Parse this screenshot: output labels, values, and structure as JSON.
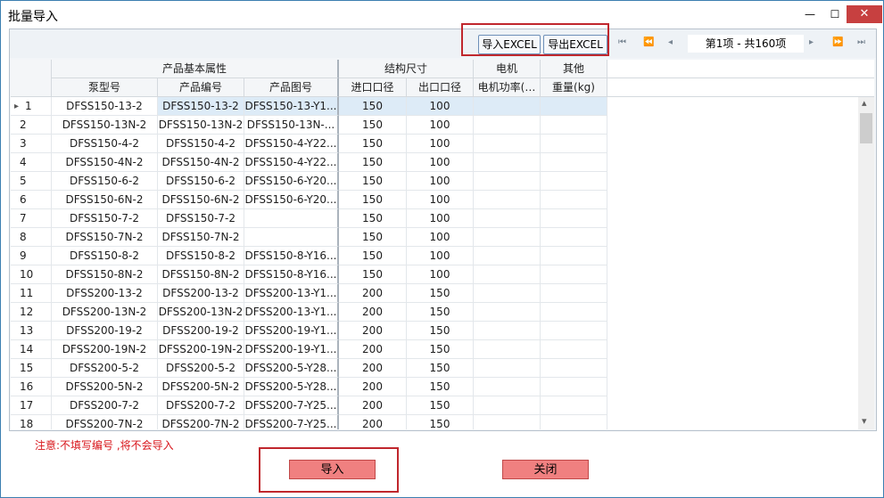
{
  "window": {
    "title": "批量导入",
    "minimize": "—",
    "maximize": "☐",
    "close": "✕"
  },
  "toolbar": {
    "import_excel": "导入EXCEL",
    "export_excel": "导出EXCEL",
    "nav_first": "⏮",
    "nav_prev": "⏪",
    "page_info": "第1项 - 共160项",
    "nav_next": "▸",
    "nav_fast": "⏩",
    "nav_last": "⏭"
  },
  "groups": {
    "basic": "产品基本属性",
    "structure": "结构尺寸",
    "motor": "电机",
    "other": "其他"
  },
  "columns": {
    "pump_model": "泵型号",
    "product_code": "产品编号",
    "product_drawing": "产品图号",
    "inlet": "进口口径",
    "outlet": "出口口径",
    "motor_power": "电机功率(…",
    "weight": "重量(kg)"
  },
  "rows": [
    {
      "n": "1",
      "model": "DFSS150-13-2",
      "code": "DFSS150-13-2",
      "drawing": "DFSS150-13-Y1...",
      "inlet": "150",
      "outlet": "100",
      "current": "▸"
    },
    {
      "n": "2",
      "model": "DFSS150-13N-2",
      "code": "DFSS150-13N-2",
      "drawing": "DFSS150-13N-...",
      "inlet": "150",
      "outlet": "100"
    },
    {
      "n": "3",
      "model": "DFSS150-4-2",
      "code": "DFSS150-4-2",
      "drawing": "DFSS150-4-Y22...",
      "inlet": "150",
      "outlet": "100"
    },
    {
      "n": "4",
      "model": "DFSS150-4N-2",
      "code": "DFSS150-4N-2",
      "drawing": "DFSS150-4-Y22...",
      "inlet": "150",
      "outlet": "100"
    },
    {
      "n": "5",
      "model": "DFSS150-6-2",
      "code": "DFSS150-6-2",
      "drawing": "DFSS150-6-Y20...",
      "inlet": "150",
      "outlet": "100"
    },
    {
      "n": "6",
      "model": "DFSS150-6N-2",
      "code": "DFSS150-6N-2",
      "drawing": "DFSS150-6-Y20...",
      "inlet": "150",
      "outlet": "100"
    },
    {
      "n": "7",
      "model": "DFSS150-7-2",
      "code": "DFSS150-7-2",
      "drawing": "",
      "inlet": "150",
      "outlet": "100"
    },
    {
      "n": "8",
      "model": "DFSS150-7N-2",
      "code": "DFSS150-7N-2",
      "drawing": "",
      "inlet": "150",
      "outlet": "100"
    },
    {
      "n": "9",
      "model": "DFSS150-8-2",
      "code": "DFSS150-8-2",
      "drawing": "DFSS150-8-Y16...",
      "inlet": "150",
      "outlet": "100"
    },
    {
      "n": "10",
      "model": "DFSS150-8N-2",
      "code": "DFSS150-8N-2",
      "drawing": "DFSS150-8-Y16...",
      "inlet": "150",
      "outlet": "100"
    },
    {
      "n": "11",
      "model": "DFSS200-13-2",
      "code": "DFSS200-13-2",
      "drawing": "DFSS200-13-Y1...",
      "inlet": "200",
      "outlet": "150"
    },
    {
      "n": "12",
      "model": "DFSS200-13N-2",
      "code": "DFSS200-13N-2",
      "drawing": "DFSS200-13-Y1...",
      "inlet": "200",
      "outlet": "150"
    },
    {
      "n": "13",
      "model": "DFSS200-19-2",
      "code": "DFSS200-19-2",
      "drawing": "DFSS200-19-Y1...",
      "inlet": "200",
      "outlet": "150"
    },
    {
      "n": "14",
      "model": "DFSS200-19N-2",
      "code": "DFSS200-19N-2",
      "drawing": "DFSS200-19-Y1...",
      "inlet": "200",
      "outlet": "150"
    },
    {
      "n": "15",
      "model": "DFSS200-5-2",
      "code": "DFSS200-5-2",
      "drawing": "DFSS200-5-Y28...",
      "inlet": "200",
      "outlet": "150"
    },
    {
      "n": "16",
      "model": "DFSS200-5N-2",
      "code": "DFSS200-5N-2",
      "drawing": "DFSS200-5-Y28...",
      "inlet": "200",
      "outlet": "150"
    },
    {
      "n": "17",
      "model": "DFSS200-7-2",
      "code": "DFSS200-7-2",
      "drawing": "DFSS200-7-Y25...",
      "inlet": "200",
      "outlet": "150"
    },
    {
      "n": "18",
      "model": "DFSS200-7N-2",
      "code": "DFSS200-7N-2",
      "drawing": "DFSS200-7-Y25...",
      "inlet": "200",
      "outlet": "150"
    }
  ],
  "scroll": {
    "up": "▴",
    "down": "▾"
  },
  "footer": {
    "note": "注意:不填写编号 ,将不会导入",
    "import_button": "导入",
    "close_button": "关闭"
  }
}
